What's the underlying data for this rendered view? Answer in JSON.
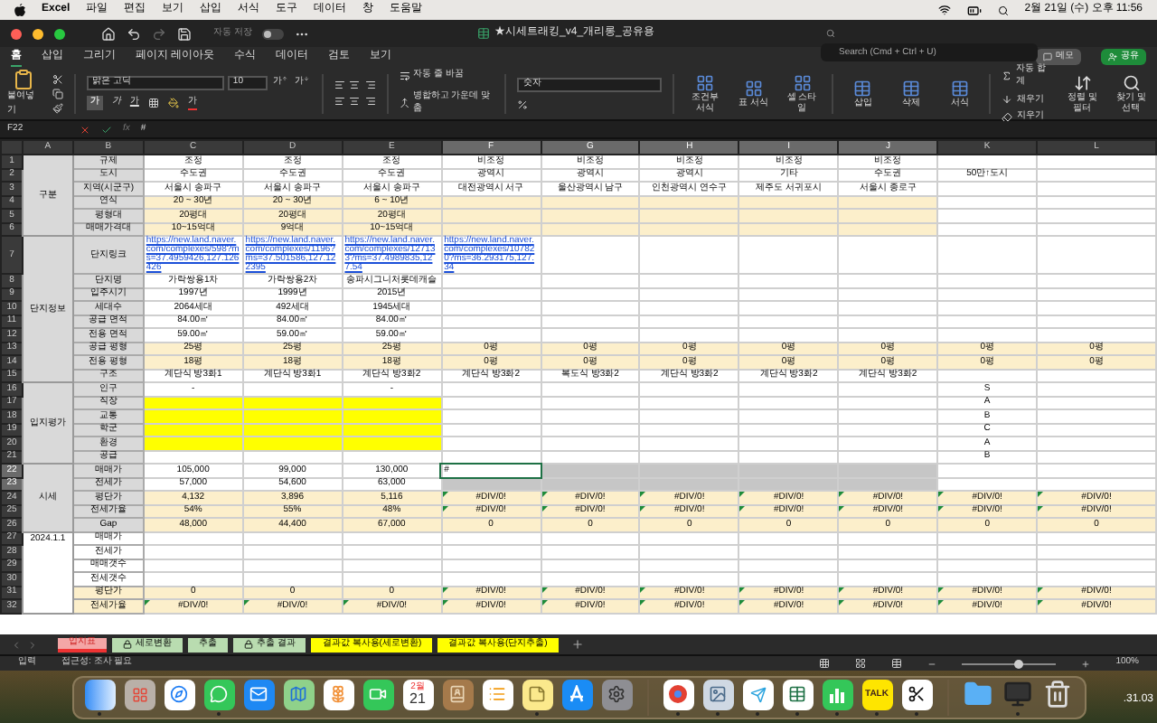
{
  "menu_bar": {
    "app": "Excel",
    "items": [
      "파일",
      "편집",
      "보기",
      "삽입",
      "서식",
      "도구",
      "데이터",
      "창",
      "도움말"
    ],
    "clock": "2월 21일 (수) 오후 11:56"
  },
  "title_bar": {
    "autosave_label": "자동 저장",
    "autosave_on": false,
    "title": "★시세트래킹_v4_개리롱_공유용",
    "search_placeholder": "Search (Cmd + Ctrl + U)"
  },
  "ribbon_tabs": [
    {
      "label": "홈",
      "selected": true
    },
    {
      "label": "삽입",
      "selected": false
    },
    {
      "label": "그리기",
      "selected": false
    },
    {
      "label": "페이지 레이아웃",
      "selected": false
    },
    {
      "label": "수식",
      "selected": false
    },
    {
      "label": "데이터",
      "selected": false
    },
    {
      "label": "검토",
      "selected": false
    },
    {
      "label": "보기",
      "selected": false
    }
  ],
  "memo_button": "메모",
  "share_button": "공유",
  "ribbon": {
    "paste": "붙여넣기",
    "font": "맑은 고딕",
    "font_size": "10",
    "grow": "가",
    "shrink": "가",
    "bold": "가",
    "italic": "가",
    "underline": "가",
    "font_color": "가",
    "wrap": "자동 줄 바꿈",
    "merge": "병합하고 가운데 맞춤",
    "number_format": "숫자",
    "conditional": "조건부 서식",
    "table_format": "표 서식",
    "cell_style": "셀 스타일",
    "insert": "삽입",
    "delete": "삭제",
    "format": "서식",
    "autosum": "자동 합계",
    "fill": "채우기",
    "clear": "지우기",
    "sort": "정렬 및 필터",
    "find": "찾기 및 선택"
  },
  "formula_bar": {
    "name_box": "F22",
    "fx": "fx",
    "formula": "#"
  },
  "sheet": {
    "columns": [
      {
        "letter": "A",
        "selected": false
      },
      {
        "letter": "B",
        "selected": false
      },
      {
        "letter": "C",
        "selected": false
      },
      {
        "letter": "D",
        "selected": false
      },
      {
        "letter": "E",
        "selected": false
      },
      {
        "letter": "F",
        "selected": true
      },
      {
        "letter": "G",
        "selected": true
      },
      {
        "letter": "H",
        "selected": true
      },
      {
        "letter": "I",
        "selected": true
      },
      {
        "letter": "J",
        "selected": true
      },
      {
        "letter": "K",
        "selected": false
      },
      {
        "letter": "L",
        "selected": false
      }
    ],
    "groups": [
      {
        "label": "구분",
        "shaded": true,
        "rows": [
          {
            "num": "1",
            "selected": false,
            "label": "규제",
            "cells": [
              "조정",
              "조정",
              "조정",
              "비조정",
              "비조정",
              "비조정",
              "비조정",
              "비조정",
              null,
              null
            ]
          },
          {
            "num": "2",
            "selected": false,
            "label": "도시",
            "cells": [
              "수도권",
              "수도권",
              "수도권",
              "광역시",
              "광역시",
              "광역시",
              "기타",
              "수도권",
              "50만↑도시",
              null
            ]
          },
          {
            "num": "3",
            "selected": false,
            "label": "지역(시군구)",
            "cells": [
              "서울시 송파구",
              "서울시 송파구",
              "서울시 송파구",
              "대전광역시 서구",
              "울산광역시 남구",
              "인천광역시 연수구",
              "제주도 서귀포시",
              "서울시 종로구",
              null,
              null
            ]
          },
          {
            "num": "4",
            "selected": false,
            "label": "연식",
            "cells": [
              {
                "t": "20 ~ 30년",
                "color": "#fcefcb"
              },
              {
                "t": "20 ~ 30년",
                "color": "#fcefcb"
              },
              {
                "t": "6 ~ 10년",
                "color": "#fcefcb"
              },
              {
                "color": "#fcefcb"
              },
              {
                "color": "#fcefcb"
              },
              {
                "color": "#fcefcb"
              },
              {
                "color": "#fcefcb"
              },
              {
                "color": "#fcefcb"
              },
              null,
              null
            ]
          },
          {
            "num": "5",
            "selected": false,
            "label": "평형대",
            "cells": [
              {
                "t": "20평대",
                "color": "#fcefcb"
              },
              {
                "t": "20평대",
                "color": "#fcefcb"
              },
              {
                "t": "20평대",
                "color": "#fcefcb"
              },
              {
                "color": "#fcefcb"
              },
              {
                "color": "#fcefcb"
              },
              {
                "color": "#fcefcb"
              },
              {
                "color": "#fcefcb"
              },
              {
                "color": "#fcefcb"
              },
              null,
              null
            ]
          },
          {
            "num": "6",
            "selected": false,
            "label": "매매가격대",
            "cells": [
              {
                "t": "10~15억대",
                "color": "#fcefcb"
              },
              {
                "t": "9억대",
                "color": "#fcefcb"
              },
              {
                "t": "10~15억대",
                "color": "#fcefcb"
              },
              {
                "color": "#fcefcb"
              },
              {
                "color": "#fcefcb"
              },
              {
                "color": "#fcefcb"
              },
              {
                "color": "#fcefcb"
              },
              {
                "color": "#fcefcb"
              },
              null,
              null
            ]
          }
        ]
      },
      {
        "label": "단지정보",
        "shaded": true,
        "rows": [
          {
            "num": "7",
            "selected": false,
            "label": "단지링크",
            "tall": true,
            "cells": [
              {
                "t": "https://new.land.naver.com/complexes/598?ms=37.4959426,127.126426",
                "link": true
              },
              {
                "t": "https://new.land.naver.com/complexes/1196?ms=37.501586,127.122395",
                "link": true
              },
              {
                "t": "https://new.land.naver.com/complexes/127133?ms=37.4989835,127.54",
                "link": true
              },
              {
                "t": "https://new.land.naver.com/complexes/107820?ms=36.293175,127.34",
                "link": true
              }
            ]
          },
          {
            "num": "8",
            "selected": false,
            "label": "단지명",
            "cells": [
              "가락쌍용1차",
              "가락쌍용2차",
              "송파시그니처롯데캐슬"
            ]
          },
          {
            "num": "9",
            "selected": false,
            "label": "입주시기",
            "cells": [
              "1997년",
              "1999년",
              "2015년"
            ]
          },
          {
            "num": "10",
            "selected": false,
            "label": "세대수",
            "cells": [
              "2064세대",
              "492세대",
              "1945세대"
            ]
          },
          {
            "num": "11",
            "selected": false,
            "label": "공급 면적",
            "cells": [
              "84.00㎡",
              "84.00㎡",
              "84.00㎡"
            ]
          },
          {
            "num": "12",
            "selected": false,
            "label": "전용 면적",
            "cells": [
              "59.00㎡",
              "59.00㎡",
              "59.00㎡"
            ]
          },
          {
            "num": "13",
            "selected": false,
            "label": "공급 평형",
            "cells": [
              {
                "t": "25평",
                "color": "#fcefcb"
              },
              {
                "t": "25평",
                "color": "#fcefcb"
              },
              {
                "t": "25평",
                "color": "#fcefcb"
              },
              {
                "t": "0평",
                "color": "#fcefcb"
              },
              {
                "t": "0평",
                "color": "#fcefcb"
              },
              {
                "t": "0평",
                "color": "#fcefcb"
              },
              {
                "t": "0평",
                "color": "#fcefcb"
              },
              {
                "t": "0평",
                "color": "#fcefcb"
              },
              {
                "t": "0평",
                "color": "#fcefcb"
              },
              {
                "t": "0평",
                "color": "#fcefcb"
              }
            ]
          },
          {
            "num": "14",
            "selected": false,
            "label": "전용 평형",
            "cells": [
              {
                "t": "18평",
                "color": "#fcefcb"
              },
              {
                "t": "18평",
                "color": "#fcefcb"
              },
              {
                "t": "18평",
                "color": "#fcefcb"
              },
              {
                "t": "0평",
                "color": "#fcefcb"
              },
              {
                "t": "0평",
                "color": "#fcefcb"
              },
              {
                "t": "0평",
                "color": "#fcefcb"
              },
              {
                "t": "0평",
                "color": "#fcefcb"
              },
              {
                "t": "0평",
                "color": "#fcefcb"
              },
              {
                "t": "0평",
                "color": "#fcefcb"
              },
              {
                "t": "0평",
                "color": "#fcefcb"
              }
            ]
          },
          {
            "num": "15",
            "selected": false,
            "label": "구조",
            "cells": [
              "계단식 방3화1",
              "계단식 방3화1",
              "계단식 방3화2",
              "계단식 방3화2",
              "복도식 방3화2",
              "계단식 방3화2",
              "계단식 방3화2",
              "계단식 방3화2",
              null,
              null
            ]
          }
        ]
      },
      {
        "label": "입지평가",
        "shaded": true,
        "rows": [
          {
            "num": "16",
            "selected": false,
            "label": "인구",
            "cells": [
              "-",
              null,
              "-",
              null,
              null,
              null,
              null,
              null,
              "S",
              null
            ]
          },
          {
            "num": "17",
            "selected": false,
            "label": "직장",
            "cells": [
              {
                "color": "#ffff00"
              },
              {
                "color": "#ffff00"
              },
              {
                "color": "#ffff00"
              },
              null,
              null,
              null,
              null,
              null,
              "A",
              null
            ]
          },
          {
            "num": "18",
            "selected": false,
            "label": "교통",
            "cells": [
              {
                "color": "#ffff00"
              },
              {
                "color": "#ffff00"
              },
              {
                "color": "#ffff00"
              },
              null,
              null,
              null,
              null,
              null,
              "B",
              null
            ]
          },
          {
            "num": "19",
            "selected": false,
            "label": "학군",
            "cells": [
              {
                "color": "#ffff00"
              },
              {
                "color": "#ffff00"
              },
              {
                "color": "#ffff00"
              },
              null,
              null,
              null,
              null,
              null,
              "C",
              null
            ]
          },
          {
            "num": "20",
            "selected": false,
            "label": "환경",
            "cells": [
              {
                "color": "#ffff00"
              },
              {
                "color": "#ffff00"
              },
              {
                "color": "#ffff00"
              },
              null,
              null,
              null,
              null,
              null,
              "A",
              null
            ]
          },
          {
            "num": "21",
            "selected": false,
            "label": "공급",
            "cells": [
              null,
              null,
              null,
              null,
              null,
              null,
              null,
              null,
              "B",
              null
            ]
          }
        ]
      },
      {
        "label": "시세",
        "shaded": true,
        "rows": [
          {
            "num": "22",
            "selected": true,
            "label": "매매가",
            "cells": [
              "105,000",
              "99,000",
              "130,000",
              {
                "t": "#",
                "selected": true,
                "active": true
              },
              {
                "selected": true
              },
              {
                "selected": true
              },
              {
                "selected": true
              },
              {
                "selected": true
              },
              null,
              null
            ]
          },
          {
            "num": "23",
            "selected": true,
            "label": "전세가",
            "cells": [
              "57,000",
              "54,600",
              "63,000",
              {
                "selected": true
              },
              {
                "selected": true
              },
              {
                "selected": true
              },
              {
                "selected": true
              },
              {
                "selected": true
              },
              null,
              null
            ]
          },
          {
            "num": "24",
            "selected": false,
            "label": "평단가",
            "cells": [
              {
                "t": "4,132",
                "color": "#fcefcb"
              },
              {
                "t": "3,896",
                "color": "#fcefcb"
              },
              {
                "t": "5,116",
                "color": "#fcefcb"
              },
              {
                "t": "#DIV/0!",
                "flag": true,
                "color": "#fcefcb"
              },
              {
                "t": "#DIV/0!",
                "flag": true,
                "color": "#fcefcb"
              },
              {
                "t": "#DIV/0!",
                "flag": true,
                "color": "#fcefcb"
              },
              {
                "t": "#DIV/0!",
                "flag": true,
                "color": "#fcefcb"
              },
              {
                "t": "#DIV/0!",
                "flag": true,
                "color": "#fcefcb"
              },
              {
                "t": "#DIV/0!",
                "flag": true,
                "color": "#fcefcb"
              },
              {
                "t": "#DIV/0!",
                "flag": true,
                "color": "#fcefcb"
              }
            ]
          },
          {
            "num": "25",
            "selected": false,
            "label": "전세가율",
            "cells": [
              {
                "t": "54%",
                "color": "#fcefcb"
              },
              {
                "t": "55%",
                "color": "#fcefcb"
              },
              {
                "t": "48%",
                "color": "#fcefcb"
              },
              {
                "t": "#DIV/0!",
                "flag": true,
                "color": "#fcefcb"
              },
              {
                "t": "#DIV/0!",
                "flag": true,
                "color": "#fcefcb"
              },
              {
                "t": "#DIV/0!",
                "flag": true,
                "color": "#fcefcb"
              },
              {
                "t": "#DIV/0!",
                "flag": true,
                "color": "#fcefcb"
              },
              {
                "t": "#DIV/0!",
                "flag": true,
                "color": "#fcefcb"
              },
              {
                "t": "#DIV/0!",
                "flag": true,
                "color": "#fcefcb"
              },
              {
                "t": "#DIV/0!",
                "flag": true,
                "color": "#fcefcb"
              }
            ]
          },
          {
            "num": "26",
            "selected": false,
            "label": "Gap",
            "cells": [
              {
                "t": "48,000",
                "color": "#fcefcb"
              },
              {
                "t": "44,400",
                "color": "#fcefcb"
              },
              {
                "t": "67,000",
                "color": "#fcefcb"
              },
              {
                "t": "0",
                "color": "#fcefcb"
              },
              {
                "t": "0",
                "color": "#fcefcb"
              },
              {
                "t": "0",
                "color": "#fcefcb"
              },
              {
                "t": "0",
                "color": "#fcefcb"
              },
              {
                "t": "0",
                "color": "#fcefcb"
              },
              {
                "t": "0",
                "color": "#fcefcb"
              },
              {
                "t": "0",
                "color": "#fcefcb"
              }
            ]
          }
        ]
      },
      {
        "label": "2024.1.1",
        "shaded": false,
        "rows": [
          {
            "num": "27",
            "selected": false,
            "label": "매매가"
          },
          {
            "num": "28",
            "selected": false,
            "label": "전세가"
          },
          {
            "num": "29",
            "selected": false,
            "label": "매매갯수"
          },
          {
            "num": "30",
            "selected": false,
            "label": "전세갯수"
          },
          {
            "num": "31",
            "selected": false,
            "label": "평단가",
            "color": "#fcefcb",
            "cells": [
              {
                "t": "0",
                "color": "#fcefcb"
              },
              {
                "t": "0",
                "color": "#fcefcb"
              },
              {
                "t": "0",
                "color": "#fcefcb"
              },
              {
                "t": "#DIV/0!",
                "flag": true,
                "color": "#fcefcb"
              },
              {
                "t": "#DIV/0!",
                "flag": true,
                "color": "#fcefcb"
              },
              {
                "t": "#DIV/0!",
                "flag": true,
                "color": "#fcefcb"
              },
              {
                "t": "#DIV/0!",
                "flag": true,
                "color": "#fcefcb"
              },
              {
                "t": "#DIV/0!",
                "flag": true,
                "color": "#fcefcb"
              },
              {
                "t": "#DIV/0!",
                "flag": true,
                "color": "#fcefcb"
              },
              {
                "t": "#DIV/0!",
                "flag": true,
                "color": "#fcefcb"
              }
            ]
          },
          {
            "num": "32",
            "selected": false,
            "label": "전세가율",
            "color": "#fcefcb",
            "cells": [
              {
                "t": "#DIV/0!",
                "flag": true,
                "color": "#fcefcb"
              },
              {
                "t": "#DIV/0!",
                "flag": true,
                "color": "#fcefcb"
              },
              {
                "t": "#DIV/0!",
                "flag": true,
                "color": "#fcefcb"
              },
              {
                "t": "#DIV/0!",
                "flag": true,
                "color": "#fcefcb"
              },
              {
                "t": "#DIV/0!",
                "flag": true,
                "color": "#fcefcb"
              },
              {
                "t": "#DIV/0!",
                "flag": true,
                "color": "#fcefcb"
              },
              {
                "t": "#DIV/0!",
                "flag": true,
                "color": "#fcefcb"
              },
              {
                "t": "#DIV/0!",
                "flag": true,
                "color": "#fcefcb"
              },
              {
                "t": "#DIV/0!",
                "flag": true,
                "color": "#fcefcb"
              },
              {
                "t": "#DIV/0!",
                "flag": true,
                "color": "#fcefcb"
              }
            ]
          }
        ]
      }
    ]
  },
  "sheet_tabs": [
    {
      "label": "입지표",
      "selected": true,
      "locked": false,
      "color": "#f4a6a6"
    },
    {
      "label": "세로변환",
      "selected": false,
      "locked": true,
      "color": "#b9dcb0"
    },
    {
      "label": "추출",
      "selected": false,
      "locked": false,
      "color": "#b9dcb0"
    },
    {
      "label": "추출 결과",
      "selected": false,
      "locked": true,
      "color": "#b9dcb0"
    },
    {
      "label": "결과값 복사용(세로변환)",
      "selected": false,
      "locked": false,
      "color": "#ffff00"
    },
    {
      "label": "결과값 복사용(단지추출)",
      "selected": false,
      "locked": false,
      "color": "#ffff00"
    }
  ],
  "status_bar": {
    "mode": "입력",
    "accessibility": "접근성: 조사 필요",
    "zoom_slider": {
      "level": 0.6
    },
    "zoom": "100%"
  },
  "dock": [
    {
      "kind": "finder",
      "running": true
    },
    {
      "kind": "launchpad",
      "running": false
    },
    {
      "kind": "safari",
      "running": false
    },
    {
      "kind": "messages",
      "running": true
    },
    {
      "kind": "mail",
      "running": false
    },
    {
      "kind": "maps",
      "running": false
    },
    {
      "kind": "photos",
      "running": false
    },
    {
      "kind": "facetime",
      "running": false
    },
    {
      "kind": "calendar",
      "running": false,
      "month": "2월",
      "day": "21"
    },
    {
      "kind": "contacts",
      "running": false
    },
    {
      "kind": "reminders",
      "running": false
    },
    {
      "kind": "notes",
      "running": true
    },
    {
      "kind": "appstore",
      "running": false
    },
    {
      "kind": "settings",
      "running": false
    },
    {
      "kind": "divider"
    },
    {
      "kind": "chrome",
      "running": true
    },
    {
      "kind": "preview",
      "running": true
    },
    {
      "kind": "telegram",
      "running": true
    },
    {
      "kind": "excel",
      "running": true
    },
    {
      "kind": "numbers",
      "running": true
    },
    {
      "kind": "kakao",
      "running": true,
      "label": "TALK"
    },
    {
      "kind": "capcut",
      "running": true
    },
    {
      "kind": "divider"
    },
    {
      "kind": "folder",
      "running": false
    },
    {
      "kind": "screenshot",
      "running": true
    },
    {
      "kind": "trash",
      "running": false
    }
  ],
  "desktop_text": ".31.03"
}
